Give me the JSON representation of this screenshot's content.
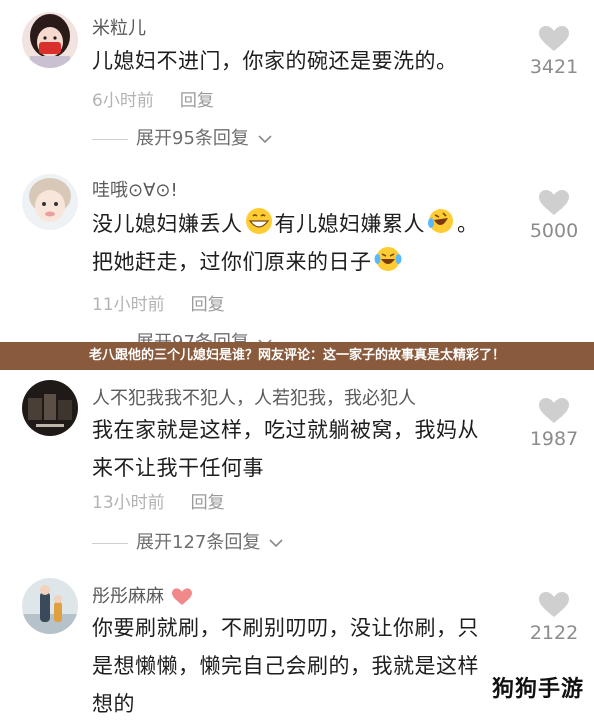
{
  "banner": "老八跟他的三个儿媳妇是谁？网友评论：这一家子的故事真是太精彩了！",
  "watermark": "狗狗手游",
  "comments": [
    {
      "user": "米粒儿",
      "lines": [
        "儿媳妇不进门，你家的碗还是要洗的。"
      ],
      "time": "6小时前",
      "reply": "回复",
      "expand": "展开95条回复",
      "likes": "3421"
    },
    {
      "user": "哇哦⊙∀⊙!",
      "line1_a": "没儿媳妇嫌丢人",
      "line1_b": "有儿媳妇嫌累人",
      "line1_c": "。",
      "line2": "把她赶走，过你们原来的日子",
      "time": "11小时前",
      "reply": "回复",
      "expand": "展开97条回复",
      "likes": "5000"
    },
    {
      "user": "人不犯我我不犯人，人若犯我，我必犯人",
      "lines": [
        "我在家就是这样，吃过就躺被窝，我妈从",
        "来不让我干任何事"
      ],
      "time": "13小时前",
      "reply": "回复",
      "expand": "展开127条回复",
      "likes": "1987"
    },
    {
      "user": "彤彤麻麻",
      "lines": [
        "你要刷就刷，不刷别叨叨，没让你刷，只",
        "是想懒懒，懒完自己会刷的，我就是这样",
        "想的"
      ],
      "likes": "2122"
    }
  ],
  "icons": {
    "heart": "heart-icon",
    "chevron": "chevron-down-icon",
    "emoji_grin": "grinning-emoji-icon",
    "emoji_laugh": "laughing-tears-emoji-icon"
  },
  "colors": {
    "banner_bg": "#8a5a3c",
    "heart": "#cfcfcf"
  }
}
